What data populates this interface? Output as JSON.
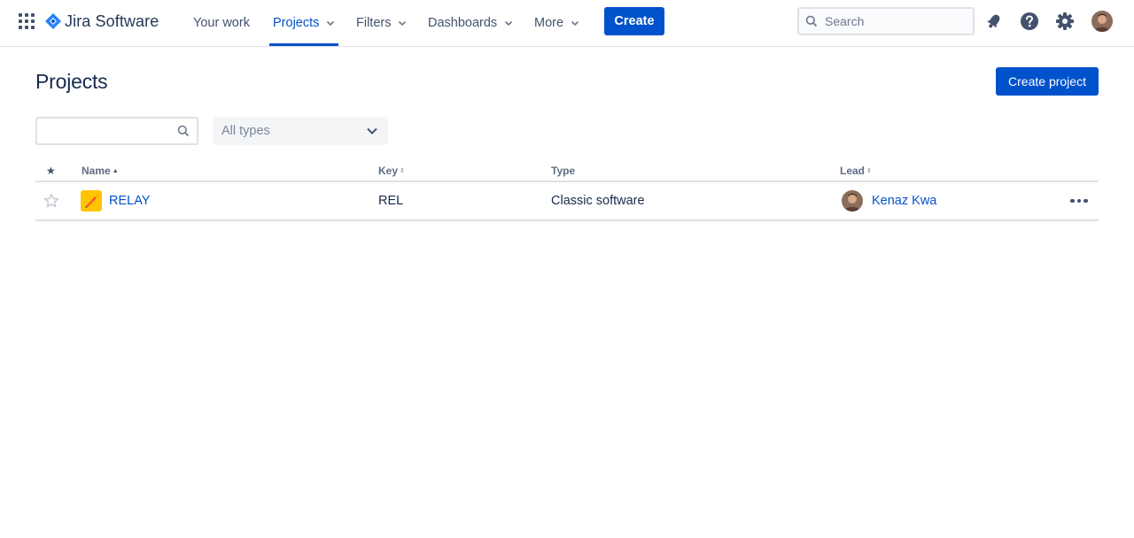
{
  "brand": {
    "name": "Jira Software",
    "color": "#0052cc"
  },
  "nav": {
    "items": [
      {
        "label": "Your work"
      },
      {
        "label": "Projects"
      },
      {
        "label": "Filters"
      },
      {
        "label": "Dashboards"
      },
      {
        "label": "More"
      }
    ],
    "active": "Projects",
    "create_label": "Create"
  },
  "search": {
    "placeholder": "Search"
  },
  "icons": {
    "app_switcher": "grid-icon",
    "notifications": "bell-icon",
    "help": "help-icon",
    "settings": "gear-icon",
    "search": "search-icon"
  },
  "page": {
    "title": "Projects",
    "create_project_label": "Create project",
    "filter": {
      "search_value": "",
      "type_select_value": "All types"
    }
  },
  "table": {
    "headers": {
      "star": "★",
      "name": "Name",
      "key": "Key",
      "type": "Type",
      "lead": "Lead"
    },
    "sorted_by": "Name",
    "rows": [
      {
        "starred": false,
        "name": "RELAY",
        "key": "REL",
        "type": "Classic software",
        "lead": "Kenaz Kwa"
      }
    ]
  }
}
